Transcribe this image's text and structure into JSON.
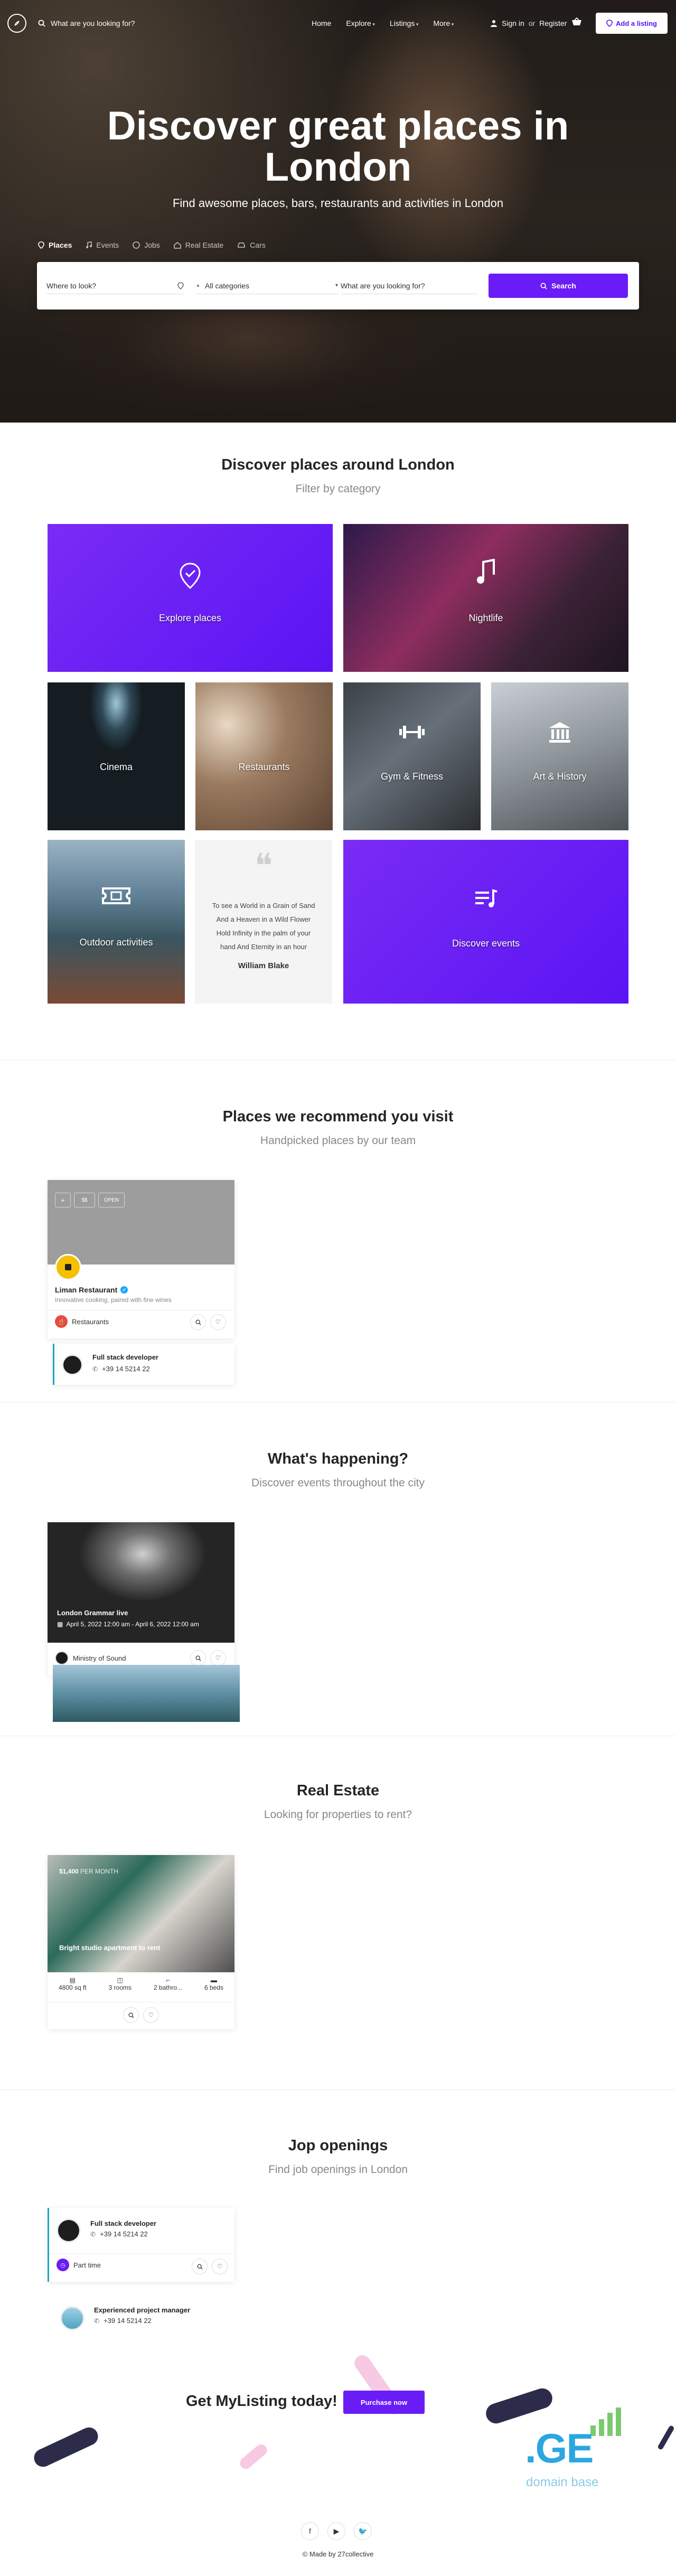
{
  "nav": {
    "search_label": "What are you looking for?",
    "menu": [
      "Home",
      "Explore",
      "Listings",
      "More"
    ],
    "signin": "Sign in",
    "or": "or",
    "register": "Register",
    "add_listing": "Add a listing"
  },
  "hero": {
    "title": "Discover great places in London",
    "subtitle": "Find awesome places, bars, restaurants and activities in London",
    "tabs": [
      "Places",
      "Events",
      "Jobs",
      "Real Estate",
      "Cars"
    ],
    "search": {
      "where_placeholder": "Where to look?",
      "category_value": "All categories",
      "what_placeholder": "What are you looking for?",
      "button": "Search"
    }
  },
  "categories": {
    "title": "Discover places around London",
    "subtitle": "Filter by category",
    "tiles": [
      "Explore places",
      "Nightlife",
      "Cinema",
      "Restaurants",
      "Gym & Fitness",
      "Art & History",
      "Outdoor activities",
      "Discover events"
    ],
    "quote": "To see a World in a Grain of Sand And a Heaven in a Wild Flower Hold Infinity in the palm of your hand And Eternity in an hour",
    "quote_author": "William Blake"
  },
  "recommend": {
    "title": "Places we recommend you visit",
    "subtitle": "Handpicked places by our team",
    "card": {
      "price": "$$",
      "status": "OPEN",
      "name": "Liman Restaurant",
      "tagline": "Innovative cooking, paired with fine wines",
      "category": "Restaurants",
      "linked_title": "Full stack developer",
      "linked_phone": "+39 14 5214 22"
    }
  },
  "events": {
    "title": "What's happening?",
    "subtitle": "Discover events throughout the city",
    "card": {
      "name": "London Grammar live",
      "date": "April 5, 2022 12:00 am - April 6, 2022 12:00 am",
      "venue": "Ministry of Sound"
    }
  },
  "realestate": {
    "title": "Real Estate",
    "subtitle": "Looking for properties to rent?",
    "card": {
      "price": "$1,400",
      "price_suffix": "PER MONTH",
      "name": "Bright studio apartment to rent",
      "stats": [
        "4800 sq ft",
        "3 rooms",
        "2 bathro...",
        "6 beds"
      ]
    }
  },
  "jobs": {
    "title": "Jop openings",
    "subtitle": "Find job openings in London",
    "items": [
      {
        "title": "Full stack developer",
        "phone": "+39 14 5214 22",
        "type": "Part time"
      },
      {
        "title": "Experienced project manager",
        "phone": "+39 14 5214 22"
      }
    ]
  },
  "cta": {
    "text": "Get MyListing today!",
    "button": "Purchase now"
  },
  "watermark": {
    "logo": ".GE",
    "sub": "domain base"
  },
  "footer": {
    "made_by": "© Made by 27collective"
  },
  "colors": {
    "accent": "#6a1cf6",
    "primary_text": "#242429",
    "muted": "#888888"
  }
}
